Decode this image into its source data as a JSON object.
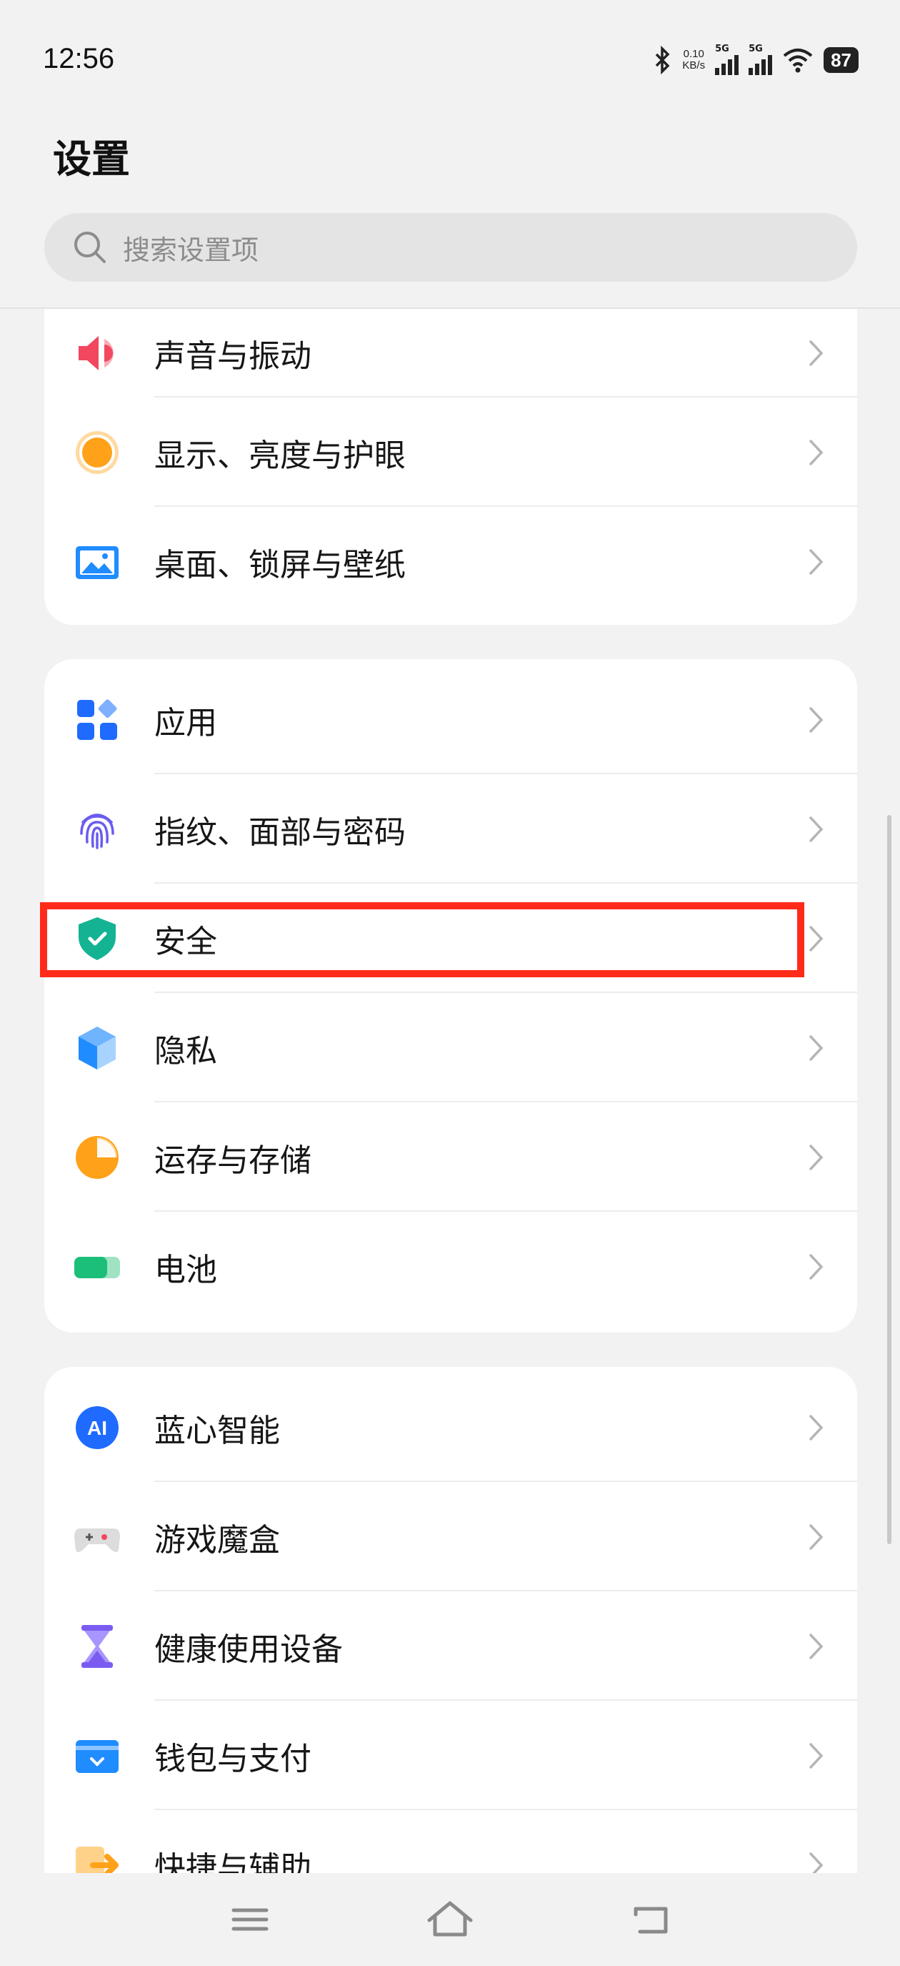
{
  "status_bar": {
    "time": "12:56",
    "net_speed_value": "0.10",
    "net_speed_unit": "KB/s",
    "sim1_label": "5G",
    "sim2_label": "5G",
    "battery": "87"
  },
  "header": {
    "title": "设置",
    "search_placeholder": "搜索设置项"
  },
  "groups": [
    {
      "items": [
        {
          "label": "声音与振动",
          "icon": "speaker-icon",
          "color": "#f2475f"
        },
        {
          "label": "显示、亮度与护眼",
          "icon": "sun-icon",
          "color": "#ffa21a"
        },
        {
          "label": "桌面、锁屏与壁纸",
          "icon": "wallpaper-icon",
          "color": "#1f8cff"
        }
      ]
    },
    {
      "items": [
        {
          "label": "应用",
          "icon": "apps-icon",
          "color": "#1f6bff"
        },
        {
          "label": "指纹、面部与密码",
          "icon": "fingerprint-icon",
          "color": "#6a5cf0"
        },
        {
          "label": "安全",
          "icon": "shield-icon",
          "color": "#14b394",
          "highlighted": true
        },
        {
          "label": "隐私",
          "icon": "privacy-cube-icon",
          "color": "#1f8cff"
        },
        {
          "label": "运存与存储",
          "icon": "pie-storage-icon",
          "color": "#ffa21a"
        },
        {
          "label": "电池",
          "icon": "battery-icon",
          "color": "#1bbf7a"
        }
      ]
    },
    {
      "items": [
        {
          "label": "蓝心智能",
          "icon": "ai-icon",
          "color": "#1f6bff"
        },
        {
          "label": "游戏魔盒",
          "icon": "gamepad-icon",
          "color": "#9a9a9a"
        },
        {
          "label": "健康使用设备",
          "icon": "hourglass-icon",
          "color": "#7b5cf0"
        },
        {
          "label": "钱包与支付",
          "icon": "wallet-icon",
          "color": "#1f8cff"
        },
        {
          "label": "快捷与辅助",
          "icon": "shortcut-icon",
          "color": "#ffa21a"
        }
      ]
    }
  ],
  "nav_bar": {
    "buttons": [
      "menu-icon",
      "home-icon",
      "back-icon"
    ]
  }
}
